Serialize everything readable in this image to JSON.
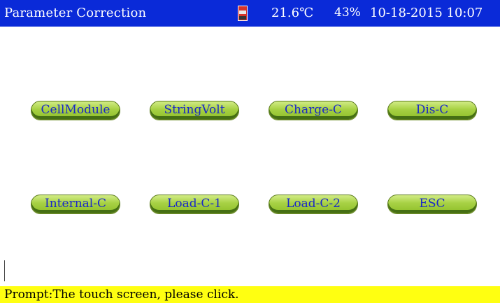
{
  "header": {
    "title": "Parameter Correction",
    "sd_icon": "sd-card-icon",
    "temperature": "21.6℃",
    "battery": "43%",
    "datetime": "10-18-2015 10:07"
  },
  "buttons": [
    {
      "label": "CellModule"
    },
    {
      "label": "StringVolt"
    },
    {
      "label": "Charge-C"
    },
    {
      "label": "Dis-C"
    },
    {
      "label": "Internal-C"
    },
    {
      "label": "Load-C-1"
    },
    {
      "label": "Load-C-2"
    },
    {
      "label": "ESC"
    }
  ],
  "prompt": {
    "text": "Prompt:The touch screen, please click."
  },
  "colors": {
    "header_bg": "#0a2ad8",
    "button_green": "#a7d144",
    "button_text": "#1a28c8",
    "prompt_bg": "#ffff11"
  }
}
